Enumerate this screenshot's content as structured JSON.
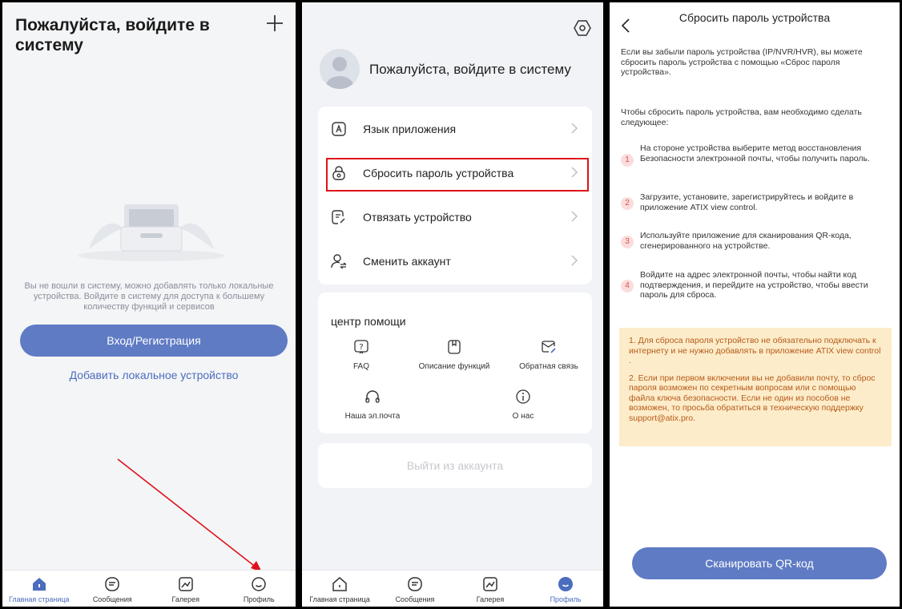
{
  "home": {
    "title": "Пожалуйста, войдите в систему",
    "hint": "Вы не вошли в систему, можно добавлять только локальные устройства. Войдите в систему для доступа к большему количеству функций и сервисов",
    "login_button": "Вход/Регистрация",
    "add_local": "Добавить локальное устройство"
  },
  "tabbar_home": [
    {
      "label": "Главная страница",
      "icon": "home-icon"
    },
    {
      "label": "Сообщения",
      "icon": "message-icon"
    },
    {
      "label": "Галерея",
      "icon": "gallery-icon"
    },
    {
      "label": "Профиль",
      "icon": "profile-icon"
    }
  ],
  "profile": {
    "prompt": "Пожалуйста, войдите в систему",
    "menu": [
      {
        "label": "Язык приложения",
        "icon": "language-icon"
      },
      {
        "label": "Сбросить пароль устройства",
        "icon": "lock-icon"
      },
      {
        "label": "Отвязать устройство",
        "icon": "unbind-icon"
      },
      {
        "label": "Сменить аккаунт",
        "icon": "switch-account-icon"
      }
    ],
    "help_title": "центр помощи",
    "help": [
      {
        "label": "FAQ",
        "icon": "faq-icon"
      },
      {
        "label": "Описание функций",
        "icon": "bookmark-icon"
      },
      {
        "label": "Обратная связь",
        "icon": "feedback-icon"
      },
      {
        "label": "Наша эл.почта",
        "icon": "headset-icon"
      },
      {
        "label": "О нас",
        "icon": "info-icon"
      }
    ],
    "logout": "Выйти из аккаунта"
  },
  "tabbar_profile": [
    {
      "label": "Главная страница",
      "icon": "home-icon"
    },
    {
      "label": "Сообщения",
      "icon": "message-icon"
    },
    {
      "label": "Галерея",
      "icon": "gallery-icon"
    },
    {
      "label": "Профиль",
      "icon": "profile-icon"
    }
  ],
  "reset": {
    "title": "Сбросить пароль устройства",
    "intro": "Если вы забыли пароль устройства (IP/NVR/HVR), вы можете сбросить пароль устройства с помощью «Сброс пароля устройства».",
    "lead": "Чтобы сбросить пароль устройства, вам необходимо сделать следующее:",
    "steps": [
      {
        "num": "1",
        "text": "На стороне устройства выберите метод восстановления Безопасности электронной почты, чтобы получить пароль."
      },
      {
        "num": "2",
        "text": "Загрузите, установите, зарегистрируйтесь и войдите в приложение ATIX view control."
      },
      {
        "num": "3",
        "text": "Используйте приложение для сканирования QR-кода, сгенерированного на устройстве."
      },
      {
        "num": "4",
        "text": "Войдите на адрес электронной почты, чтобы найти код подтверждения, и перейдите на устройство, чтобы ввести пароль для сброса."
      }
    ],
    "notes": [
      "1. Для сброса пароля устройство не обязательно подключать к интернету и не нужно добавлять в приложение ATIX view control .",
      "2. Если при первом включении вы не добавили почту, то сброс пароля возможен по секретным вопросам или с помощью файла ключа безопасности. Если не один из пособов не возможен, то просьба обратиться в техническую поддержку support@atix.pro."
    ],
    "scan_button": "Сканировать QR-код"
  },
  "colors": {
    "accent": "#5f7bc4",
    "highlight": "#e0101a",
    "note_bg": "#fdecc9",
    "note_text": "#b55a1a"
  }
}
